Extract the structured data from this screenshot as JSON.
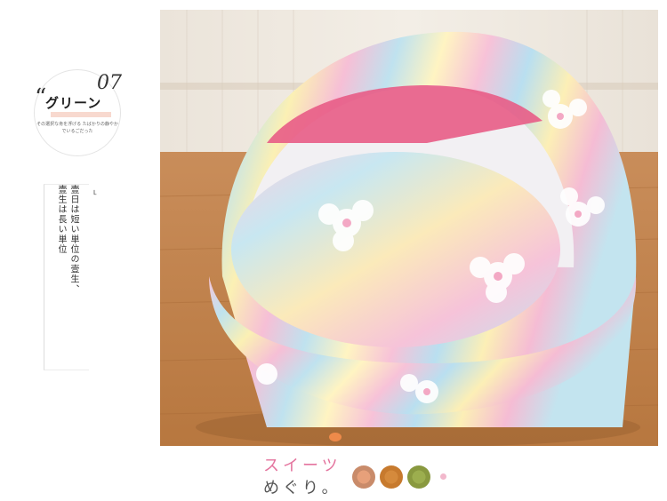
{
  "badge": {
    "quote": "“",
    "number": "07",
    "title": "グリーン",
    "subtitle": "その選択な肯を浮げる たばかりの静やかでいるごだった"
  },
  "vertical_text": {
    "col1": "壹日は短い単位の壹生、",
    "col2": "壹生は長い単位",
    "mark": "˪"
  },
  "photo": {
    "description_icon": "pet-bed-photo"
  },
  "footer": {
    "line1": "スイーツ",
    "line2": "めぐり。",
    "accent_pink": "#e4749e"
  }
}
